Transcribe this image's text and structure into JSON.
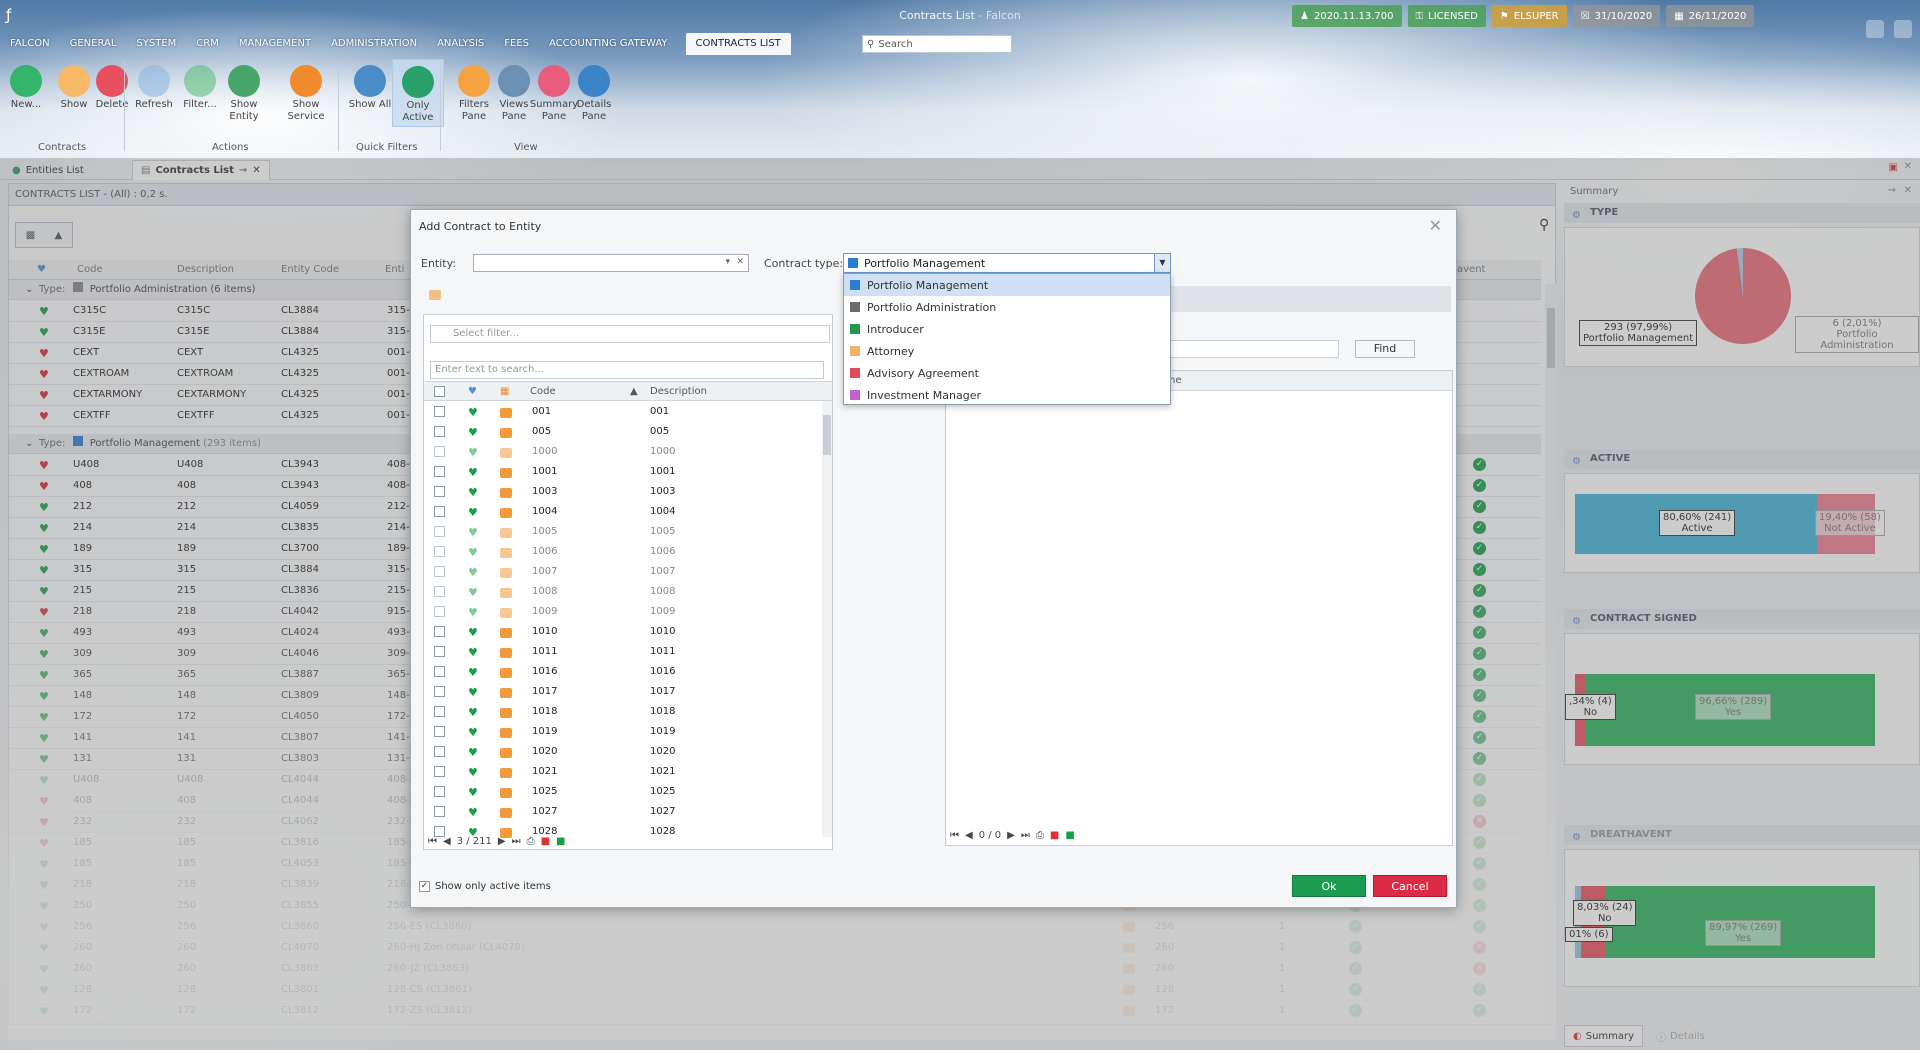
{
  "window": {
    "title": "Contracts List",
    "app_suffix": " - Falcon"
  },
  "status_chips": [
    {
      "icon": "person-icon",
      "text": "2020.11.13.700",
      "color": "#4ca05a"
    },
    {
      "icon": "key-icon",
      "text": "LICENSED",
      "color": "#4ca05a"
    },
    {
      "icon": "user-badge-icon",
      "text": "ELSUPER",
      "color": "#cda03c"
    },
    {
      "icon": "lock-icon",
      "text": "31/10/2020",
      "color": "#969696"
    },
    {
      "icon": "calendar-icon",
      "text": "26/11/2020",
      "color": "#969696"
    }
  ],
  "menu": [
    "FALCON",
    "GENERAL",
    "SYSTEM",
    "CRM",
    "MANAGEMENT",
    "ADMINISTRATION",
    "ANALYSIS",
    "FEES",
    "ACCOUNTING GATEWAY",
    "CONTRACTS LIST"
  ],
  "search": {
    "placeholder": "Search"
  },
  "ribbon": {
    "buttons": [
      {
        "label": "New...",
        "icon": "add-icon"
      },
      {
        "label": "Show",
        "icon": "folder-icon"
      },
      {
        "label": "Delete",
        "icon": "delete-icon"
      },
      {
        "label": "Refresh",
        "icon": "refresh-icon"
      },
      {
        "label": "Filter...",
        "icon": "filter-add-icon"
      },
      {
        "label": "Show Entity",
        "icon": "entity-icon"
      },
      {
        "label": "Show Service",
        "icon": "service-icon"
      },
      {
        "label": "Show All",
        "icon": "pulse-icon"
      },
      {
        "label": "Only Active",
        "icon": "pulse-active-icon"
      },
      {
        "label": "Filters Pane",
        "icon": "filters-pane-icon"
      },
      {
        "label": "Views Pane",
        "icon": "views-pane-icon"
      },
      {
        "label": "Summary Pane",
        "icon": "summary-pane-icon"
      },
      {
        "label": "Details Pane",
        "icon": "details-pane-icon"
      }
    ],
    "groups": [
      "Contracts",
      "Actions",
      "Quick Filters",
      "View"
    ]
  },
  "doc_tabs": [
    "Entities List",
    "Contracts List"
  ],
  "contracts": {
    "header": "CONTRACTS LIST - (All) : 0,2 s.",
    "columns": [
      "Code",
      "Description",
      "Entity Code",
      "Enti",
      "avent"
    ],
    "groups": [
      {
        "label": "Type:",
        "name": "Portfolio Administration",
        "count": "(6 items)"
      },
      {
        "label": "Type:",
        "name": "Portfolio Management",
        "count": "(293 items)"
      }
    ],
    "rows_admin": [
      {
        "code": "C315C",
        "desc": "C315C",
        "ent": "CL3884",
        "e": "315-",
        "heart": "#1b9e4b"
      },
      {
        "code": "C315E",
        "desc": "C315E",
        "ent": "CL3884",
        "e": "315-",
        "heart": "#1b9e4b"
      },
      {
        "code": "CEXT",
        "desc": "CEXT",
        "ent": "CL4325",
        "e": "001-",
        "heart": "#d8293d"
      },
      {
        "code": "CEXTROAM",
        "desc": "CEXTROAM",
        "ent": "CL4325",
        "e": "001-",
        "heart": "#d8293d"
      },
      {
        "code": "CEXTARMONY",
        "desc": "CEXTARMONY",
        "ent": "CL4325",
        "e": "001-",
        "heart": "#d8293d"
      },
      {
        "code": "CEXTFF",
        "desc": "CEXTFF",
        "ent": "CL4325",
        "e": "001-",
        "heart": "#d8293d"
      }
    ],
    "rows_pm": [
      {
        "code": "U408",
        "desc": "U408",
        "ent": "CL3943",
        "e": "408-",
        "heart": "#d8293d",
        "s": "ok"
      },
      {
        "code": "408",
        "desc": "408",
        "ent": "CL3943",
        "e": "408-",
        "heart": "#d8293d",
        "s": "ok"
      },
      {
        "code": "212",
        "desc": "212",
        "ent": "CL4059",
        "e": "212-",
        "heart": "#1b9e4b",
        "s": "ok"
      },
      {
        "code": "214",
        "desc": "214",
        "ent": "CL3835",
        "e": "214-",
        "heart": "#1b9e4b",
        "s": "ok"
      },
      {
        "code": "189",
        "desc": "189",
        "ent": "CL3700",
        "e": "189-",
        "heart": "#1b9e4b",
        "s": "ok"
      },
      {
        "code": "315",
        "desc": "315",
        "ent": "CL3884",
        "e": "315-",
        "heart": "#1b9e4b",
        "s": "ok"
      },
      {
        "code": "215",
        "desc": "215",
        "ent": "CL3836",
        "e": "215-",
        "heart": "#1b9e4b",
        "s": "ok"
      },
      {
        "code": "218",
        "desc": "218",
        "ent": "CL4042",
        "e": "915-",
        "heart": "#d8293d",
        "s": "ok"
      },
      {
        "code": "493",
        "desc": "493",
        "ent": "CL4024",
        "e": "493-",
        "heart": "#1b9e4b",
        "s": "ok"
      },
      {
        "code": "309",
        "desc": "309",
        "ent": "CL4046",
        "e": "309-",
        "heart": "#1b9e4b",
        "s": "ok"
      },
      {
        "code": "365",
        "desc": "365",
        "ent": "CL3887",
        "e": "365-",
        "heart": "#1b9e4b",
        "s": "ok"
      },
      {
        "code": "148",
        "desc": "148",
        "ent": "CL3809",
        "e": "148-",
        "heart": "#1b9e4b",
        "s": "ok"
      },
      {
        "code": "172",
        "desc": "172",
        "ent": "CL4050",
        "e": "172-",
        "heart": "#1b9e4b",
        "s": "ok"
      },
      {
        "code": "141",
        "desc": "141",
        "ent": "CL3807",
        "e": "141-",
        "heart": "#1b9e4b",
        "s": "ok"
      },
      {
        "code": "131",
        "desc": "131",
        "ent": "CL3803",
        "e": "131-",
        "heart": "#1b9e4b",
        "s": "ok"
      },
      {
        "code": "U408",
        "desc": "U408",
        "ent": "CL4044",
        "e": "408-",
        "heart": "#1b9e4b",
        "s": "ok"
      },
      {
        "code": "408",
        "desc": "408",
        "ent": "CL4044",
        "e": "408-",
        "heart": "#d8293d",
        "s": "ok"
      },
      {
        "code": "232",
        "desc": "232",
        "ent": "CL4062",
        "e": "232-",
        "heart": "#d8293d",
        "s": "ko"
      },
      {
        "code": "185",
        "desc": "185",
        "ent": "CL3816",
        "e": "185-",
        "heart": "#d8293d",
        "s": "ok"
      },
      {
        "code": "185",
        "desc": "185",
        "ent": "CL4053",
        "e": "185-",
        "heart": "#1b9e4b",
        "s": "ok"
      },
      {
        "code": "218",
        "desc": "218",
        "ent": "CL3839",
        "e": "218-",
        "heart": "#1b9e4b",
        "s": "ok"
      }
    ],
    "rows_wide": [
      {
        "code": "250",
        "desc": "250",
        "ent": "CL3855",
        "e": "250-AG  (CL3855)",
        "n": "250",
        "one": "1",
        "a": "ok",
        "s": "ok"
      },
      {
        "code": "256",
        "desc": "256",
        "ent": "CL3860",
        "e": "256-ES  (CL3860)",
        "n": "256",
        "one": "1",
        "a": "ok",
        "s": "ok"
      },
      {
        "code": "260",
        "desc": "260",
        "ent": "CL4070",
        "e": "260-HJ Zon titular  (CL4070)",
        "n": "260",
        "one": "1",
        "a": "ok",
        "s": "ko"
      },
      {
        "code": "260",
        "desc": "260",
        "ent": "CL3863",
        "e": "260-JZ  (CL3863)",
        "n": "260",
        "one": "1",
        "a": "ok",
        "s": "ko"
      },
      {
        "code": "128",
        "desc": "128",
        "ent": "CL3801",
        "e": "128-CS  (CL3801)",
        "n": "128",
        "one": "1",
        "a": "ok",
        "s": "ok"
      },
      {
        "code": "172",
        "desc": "172",
        "ent": "CL3812",
        "e": "172-ZS  (CL3812)",
        "n": "172",
        "one": "1",
        "a": "ok",
        "s": "ok"
      }
    ]
  },
  "dialog": {
    "title": "Add Contract to Entity",
    "entity_label": "Entity:",
    "type_label": "Contract type:",
    "type_value": "Portfolio Management",
    "options": [
      {
        "label": "Portfolio Management",
        "color": "#2a7dd1"
      },
      {
        "label": "Portfolio Administration",
        "color": "#6b6b6b"
      },
      {
        "label": "Introducer",
        "color": "#1f9a4b"
      },
      {
        "label": "Attorney",
        "color": "#f2b068"
      },
      {
        "label": "Advisory Agreement",
        "color": "#e04a5c"
      },
      {
        "label": "Investment Manager",
        "color": "#c65fd0"
      }
    ],
    "filter_placeholder": "Select filter...",
    "search_placeholder": "Enter text to search...",
    "find": "Find",
    "left_columns": [
      "Code",
      "Description"
    ],
    "right_columns": [
      "Name"
    ],
    "left_rows": [
      {
        "code": "001",
        "desc": "001",
        "heart": "#1b9e4b"
      },
      {
        "code": "005",
        "desc": "005",
        "heart": "#1b9e4b"
      },
      {
        "code": "1000",
        "desc": "1000",
        "heart": "#1b9e4b"
      },
      {
        "code": "1001",
        "desc": "1001",
        "heart": "#1b9e4b"
      },
      {
        "code": "1003",
        "desc": "1003",
        "heart": "#1b9e4b"
      },
      {
        "code": "1004",
        "desc": "1004",
        "heart": "#1b9e4b"
      },
      {
        "code": "1005",
        "desc": "1005",
        "heart": "#1b9e4b"
      },
      {
        "code": "1006",
        "desc": "1006",
        "heart": "#1b9e4b"
      },
      {
        "code": "1007",
        "desc": "1007",
        "heart": "#1b9e4b"
      },
      {
        "code": "1008",
        "desc": "1008",
        "heart": "#1b9e4b"
      },
      {
        "code": "1009",
        "desc": "1009",
        "heart": "#1b9e4b"
      },
      {
        "code": "1010",
        "desc": "1010",
        "heart": "#1b9e4b"
      },
      {
        "code": "1011",
        "desc": "1011",
        "heart": "#1b9e4b"
      },
      {
        "code": "1016",
        "desc": "1016",
        "heart": "#1b9e4b"
      },
      {
        "code": "1017",
        "desc": "1017",
        "heart": "#1b9e4b"
      },
      {
        "code": "1018",
        "desc": "1018",
        "heart": "#1b9e4b"
      },
      {
        "code": "1019",
        "desc": "1019",
        "heart": "#1b9e4b"
      },
      {
        "code": "1020",
        "desc": "1020",
        "heart": "#1b9e4b"
      },
      {
        "code": "1021",
        "desc": "1021",
        "heart": "#1b9e4b"
      },
      {
        "code": "1025",
        "desc": "1025",
        "heart": "#1b9e4b"
      },
      {
        "code": "1027",
        "desc": "1027",
        "heart": "#1b9e4b"
      },
      {
        "code": "1028",
        "desc": "1028",
        "heart": "#1b9e4b"
      }
    ],
    "left_pager": "3 / 211",
    "right_pager": "0 / 0",
    "show_active": "Show only active items",
    "ok": "Ok",
    "cancel": "Cancel"
  },
  "summary": {
    "title": "Summary",
    "sections": [
      "TYPE",
      "ACTIVE",
      "CONTRACT SIGNED",
      "DREATHAVENT"
    ],
    "type_pm": {
      "value": "293 (97,99%)",
      "name": "Portfolio Management"
    },
    "type_pa": {
      "value": "6 (2,01%)",
      "name": "Portfolio Administration"
    },
    "active_yes": {
      "value": "80,60% (241)",
      "name": "Active"
    },
    "active_no": {
      "value": "19,40% (58)",
      "name": "Not Active"
    },
    "signed_no": {
      "value": ",34% (4)",
      "name": "No"
    },
    "signed_yes": {
      "value": "96,66% (289)",
      "name": "Yes"
    },
    "dreat_no": {
      "value": "8,03% (24)",
      "name": "No"
    },
    "dreat_other": {
      "value": "01% (6)"
    },
    "dreat_yes": {
      "value": "89,97% (269)",
      "name": "Yes"
    },
    "tabs": [
      "Summary",
      "Details"
    ]
  },
  "chart_data": [
    {
      "type": "pie",
      "title": "TYPE",
      "categories": [
        "Portfolio Management",
        "Portfolio Administration"
      ],
      "values": [
        293,
        6
      ]
    },
    {
      "type": "bar",
      "title": "ACTIVE",
      "categories": [
        "Active",
        "Not Active"
      ],
      "values": [
        80.6,
        19.4
      ]
    },
    {
      "type": "bar",
      "title": "CONTRACT SIGNED",
      "categories": [
        "No",
        "Yes"
      ],
      "values": [
        3.34,
        96.66
      ]
    },
    {
      "type": "bar",
      "title": "DREATHAVENT",
      "categories": [
        "",
        "No",
        "Yes"
      ],
      "values": [
        2.01,
        8.03,
        89.97
      ]
    }
  ]
}
